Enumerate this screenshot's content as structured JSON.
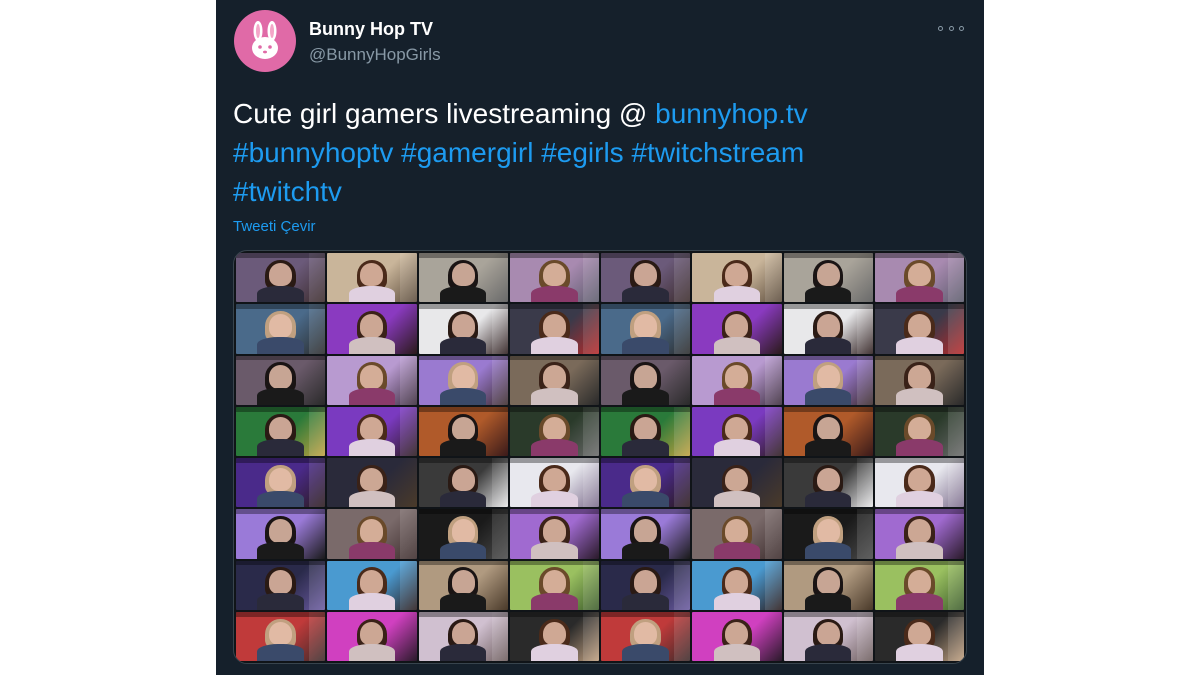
{
  "tweet": {
    "display_name": "Bunny Hop TV",
    "handle": "@BunnyHopGirls",
    "text_plain": "Cute girl gamers livestreaming @ ",
    "link": "bunnyhop.tv",
    "hashtags": [
      "#bunnyhoptv",
      "#gamergirl",
      "#egirls",
      "#twitchstream",
      "#twitchtv"
    ],
    "translate_label": "Tweeti Çevir",
    "avatar_icon": "bunny-icon",
    "more_icon": "more-options-icon"
  },
  "colors": {
    "background": "#15202b",
    "text": "#ffffff",
    "secondary": "#8899a6",
    "accent": "#1d9bf0",
    "avatar_bg": "#e06aa7"
  },
  "media": {
    "description_icon": "stream-collage",
    "tile_palette": [
      [
        "#6b5a7a",
        "#3a2a2a"
      ],
      [
        "#c9b59a",
        "#5a4a3a"
      ],
      [
        "#a9a49a",
        "#6a6a6a"
      ],
      [
        "#a88ab0",
        "#5a5a6a"
      ],
      [
        "#4a6a8a",
        "#2a2a2a"
      ],
      [
        "#8a3ac0",
        "#2a1a1a"
      ],
      [
        "#e8e8ea",
        "#2a1a1a"
      ],
      [
        "#3a3a4a",
        "#b82a2a"
      ],
      [
        "#6a5a6a",
        "#2a2a2a"
      ],
      [
        "#b89ad0",
        "#3a2a3a"
      ],
      [
        "#9a7ad0",
        "#3a2a2a"
      ],
      [
        "#7a6a5a",
        "#2a2a2a"
      ],
      [
        "#2a7a3a",
        "#c0a040"
      ],
      [
        "#7a3ac0",
        "#2a1a1a"
      ],
      [
        "#b05a2a",
        "#3a1a1a"
      ],
      [
        "#2a3a2a",
        "#6a6a6a"
      ],
      [
        "#4a2a8a",
        "#2a1a1a"
      ],
      [
        "#2a2a3a",
        "#4a3a2a"
      ],
      [
        "#3a3a3a",
        "#e8e8ea"
      ],
      [
        "#e8e8ee",
        "#7a6a8a"
      ],
      [
        "#9a7ad8",
        "#1a1a1a"
      ],
      [
        "#7a6a6a",
        "#3a2a2a"
      ],
      [
        "#1a1a1a",
        "#4a4a4a"
      ],
      [
        "#a06ad0",
        "#2a1a2a"
      ],
      [
        "#2a2a4a",
        "#6a5aa0"
      ],
      [
        "#4a9ad0",
        "#2a1a1a"
      ],
      [
        "#b09a80",
        "#4a3a2a"
      ],
      [
        "#9ac060",
        "#3a5a2a"
      ],
      [
        "#c03a3a",
        "#3a2a2a"
      ],
      [
        "#d040c0",
        "#2a1a2a"
      ],
      [
        "#d0c0d0",
        "#6a5a5a"
      ],
      [
        "#2a2a2a",
        "#c0a080"
      ]
    ]
  }
}
